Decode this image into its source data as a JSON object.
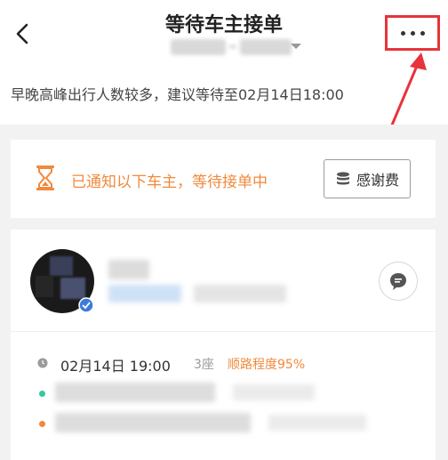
{
  "header": {
    "title": "等待车主接单",
    "back_icon": "chevron-left-icon",
    "more_icon": "more-horizontal-icon"
  },
  "hint": {
    "text": "早晚高峰出行人数较多，建议等待至02月14日18:00"
  },
  "status_card": {
    "text": "已通知以下车主，等待接单中",
    "thanks_label": "感谢费",
    "accent_color": "#f08a3c"
  },
  "driver": {
    "trip_time": "02月14日 19:00",
    "seats": "3座",
    "match": "顺路程度95%",
    "start_dot_color": "#37c5a0",
    "end_dot_color": "#f08a3c"
  },
  "colors": {
    "annotation": "#e8333a"
  }
}
